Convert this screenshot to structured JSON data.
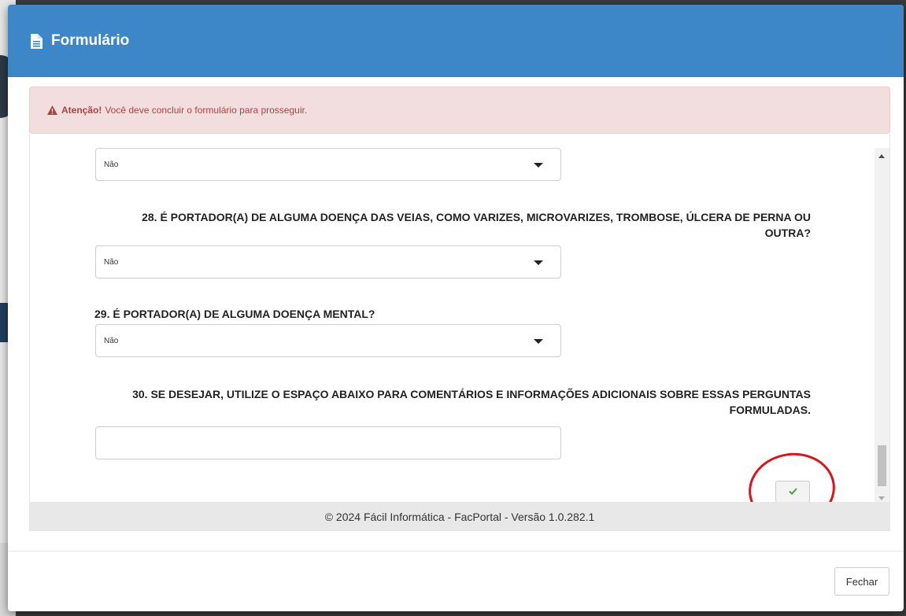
{
  "modal": {
    "title": "Formulário",
    "title_icon": "file-text-icon"
  },
  "alert": {
    "strong": "Atenção!",
    "message": "Você deve concluir o formulário para prosseguir.",
    "icon": "warning-triangle-icon"
  },
  "form": {
    "q27_answer": "Não",
    "q28_label": "28. É PORTADOR(A) DE ALGUMA DOENÇA DAS VEIAS, COMO VARIZES, MICROVARIZES, TROMBOSE, ÚLCERA DE PERNA OU OUTRA?",
    "q28_answer": "Não",
    "q29_label": "29. É PORTADOR(A) DE ALGUMA DOENÇA MENTAL?",
    "q29_answer": "Não",
    "q30_label": "30. SE DESEJAR, UTILIZE O ESPAÇO ABAIXO PARA COMENTÁRIOS E INFORMAÇÕES ADICIONAIS SOBRE ESSAS PERGUNTAS FORMULADAS.",
    "q30_value": "",
    "submit_icon": "check-icon"
  },
  "footer": {
    "copyright": "© 2024 Fácil Informática - FacPortal - Versão 1.0.282.1"
  },
  "actions": {
    "close_label": "Fechar"
  },
  "colors": {
    "header": "#3d86c8",
    "alert_bg": "#f2dede",
    "alert_text": "#a94442",
    "check": "#3aa63a",
    "highlight": "#e0111a"
  }
}
